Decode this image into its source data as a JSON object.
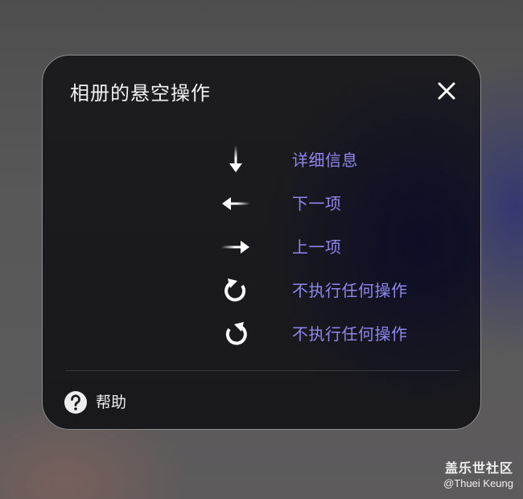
{
  "dialog": {
    "title": "相册的悬空操作",
    "close_icon": "close-icon"
  },
  "actions": [
    {
      "icon": "arrow-down-icon",
      "label": "详细信息"
    },
    {
      "icon": "arrow-left-icon",
      "label": "下一项"
    },
    {
      "icon": "arrow-right-icon",
      "label": "上一项"
    },
    {
      "icon": "rotate-clockwise-icon",
      "label": "不执行任何操作"
    },
    {
      "icon": "rotate-counterclockwise-icon",
      "label": "不执行任何操作"
    }
  ],
  "help": {
    "icon": "question-circle-icon",
    "label": "帮助"
  },
  "watermark": {
    "brand": "盖乐世社区",
    "user": "@Thuei  Keung"
  },
  "colors": {
    "accent": "#8f87f0",
    "dialog_bg": "#1b1b1e",
    "text": "#f2f2f2"
  }
}
